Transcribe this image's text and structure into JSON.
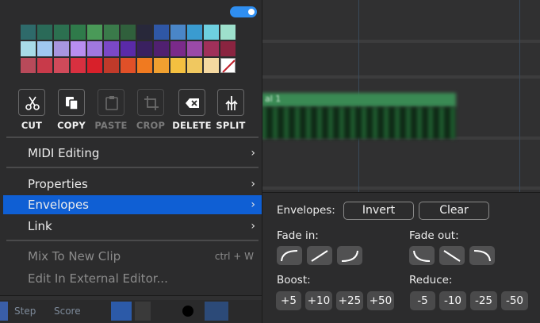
{
  "colors": {
    "accent": "#0f5fd4",
    "toggle": "#2f8ef0",
    "clip": "#3a8a54"
  },
  "swatches": [
    [
      "#2e6a6a",
      "#2a6a58",
      "#2c7050",
      "#2f7a4a",
      "#4a9a58",
      "#3a7a4a",
      "#30603c",
      "#28283a",
      "#2f57a6",
      "#4a86c8",
      "#3a9bd0",
      "#6ed0e0",
      "#9ee0cc"
    ],
    [
      "#a8dce8",
      "#a0c8f0",
      "#a896e0",
      "#b88ef0",
      "#a078e0",
      "#7b48c8",
      "#5a2aa8",
      "#3a2060",
      "#502070",
      "#7a2a8a",
      "#9a4aa8",
      "#a0305a",
      "#8a2440"
    ],
    [
      "#b84a5a",
      "#c83a4a",
      "#d04a5a",
      "#d83040",
      "#d8202a",
      "#c03a2a",
      "#e05028",
      "#f07a20",
      "#f0a030",
      "#f4c040",
      "#f0c860",
      "#f4d8a0",
      "none"
    ]
  ],
  "tools": [
    {
      "label": "CUT",
      "icon": "scissors-icon",
      "enabled": true
    },
    {
      "label": "COPY",
      "icon": "copy-icon",
      "enabled": true
    },
    {
      "label": "PASTE",
      "icon": "clipboard-icon",
      "enabled": false
    },
    {
      "label": "CROP",
      "icon": "crop-icon",
      "enabled": false
    },
    {
      "label": "DELETE",
      "icon": "backspace-icon",
      "enabled": true
    },
    {
      "label": "SPLIT",
      "icon": "split-icon",
      "enabled": true
    }
  ],
  "menu": {
    "midi_editing": "MIDI Editing",
    "properties": "Properties",
    "envelopes": "Envelopes",
    "link": "Link",
    "mix_to_new_clip": "Mix To New Clip",
    "mix_shortcut": "ctrl + W",
    "edit_external": "Edit In External Editor...",
    "arrow": "›"
  },
  "submenu": {
    "envelopes_label": "Envelopes:",
    "invert": "Invert",
    "clear": "Clear",
    "fade_in": "Fade in:",
    "fade_out": "Fade out:",
    "boost": "Boost:",
    "reduce": "Reduce:",
    "boost_values": [
      "+5",
      "+10",
      "+25",
      "+50"
    ],
    "reduce_values": [
      "-5",
      "-10",
      "-25",
      "-50"
    ]
  },
  "background": {
    "clip_label": "al 1",
    "bottom_items": [
      "Step",
      "Score"
    ]
  }
}
